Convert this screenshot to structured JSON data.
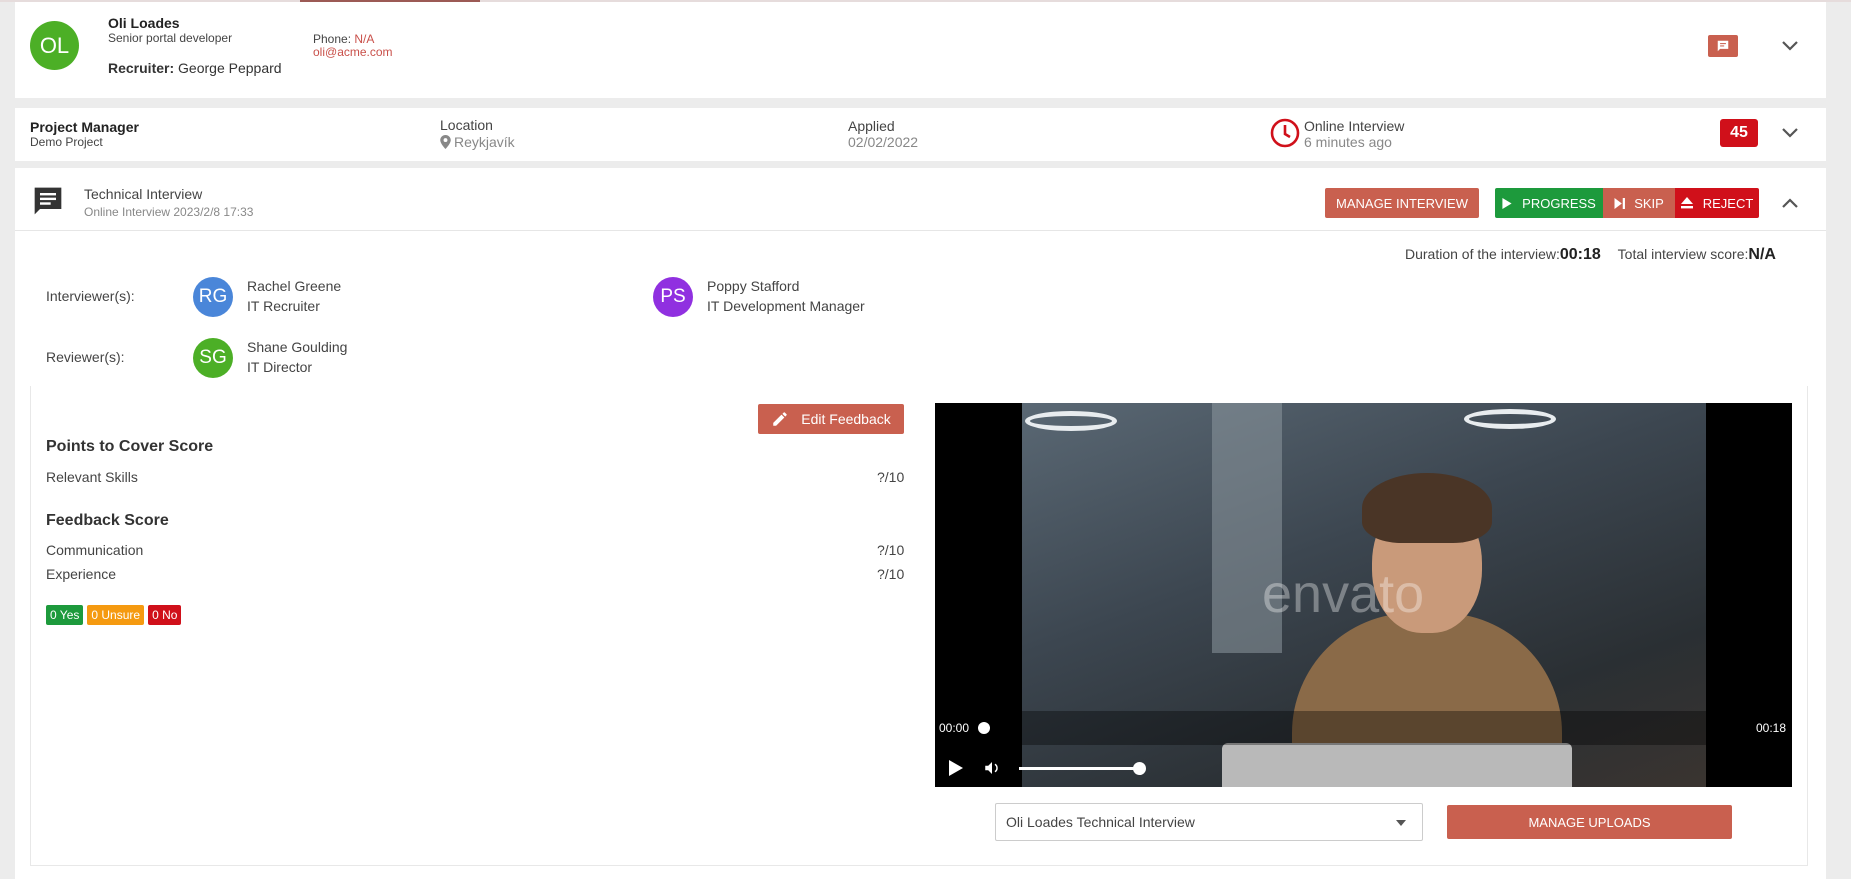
{
  "candidate": {
    "initials": "OL",
    "name": "Oli Loades",
    "title": "Senior portal developer",
    "recruiter_label": "Recruiter:",
    "recruiter": "George Peppard",
    "phone_label": "Phone:",
    "phone": "N/A",
    "email": "oli@acme.com",
    "avatar_color": "#4caf26"
  },
  "application": {
    "job_title": "Project Manager",
    "project": "Demo Project",
    "location_label": "Location",
    "location": "Reykjavík",
    "applied_label": "Applied",
    "applied": "02/02/2022",
    "stage": "Online Interview",
    "stage_time": "6 minutes ago",
    "count": "45"
  },
  "interview": {
    "title": "Technical Interview",
    "subtitle": "Online Interview 2023/2/8 17:33",
    "manage_label": "MANAGE INTERVIEW",
    "progress_label": "PROGRESS",
    "skip_label": "SKIP",
    "reject_label": "REJECT",
    "duration_label": "Duration of the interview:",
    "duration": "00:18",
    "total_label": "Total interview score:",
    "total": "N/A",
    "interviewers_label": "Interviewer(s):",
    "reviewers_label": "Reviewer(s):",
    "interviewers": [
      {
        "initials": "RG",
        "name": "Rachel Greene",
        "role": "IT Recruiter",
        "color": "#4a86d9"
      },
      {
        "initials": "PS",
        "name": "Poppy Stafford",
        "role": "IT Development Manager",
        "color": "#9030e0"
      }
    ],
    "reviewers": [
      {
        "initials": "SG",
        "name": "Shane Goulding",
        "role": "IT Director",
        "color": "#4caf26"
      }
    ]
  },
  "feedback": {
    "edit_label": "Edit Feedback",
    "points_heading": "Points to Cover Score",
    "points": [
      {
        "label": "Relevant Skills",
        "score": "?/10"
      }
    ],
    "feedback_heading": "Feedback Score",
    "scores": [
      {
        "label": "Communication",
        "score": "?/10"
      },
      {
        "label": "Experience",
        "score": "?/10"
      }
    ],
    "votes": {
      "yes": "0 Yes",
      "unsure": "0 Unsure",
      "no": "0 No"
    }
  },
  "video": {
    "current": "00:00",
    "total": "00:18",
    "progress": 0,
    "volume": 0.8,
    "watermark": "envato"
  },
  "uploads": {
    "selected": "Oli Loades Technical Interview",
    "manage_label": "MANAGE UPLOADS"
  },
  "colors": {
    "accent": "#c9604f",
    "progress": "#1d9a3c",
    "skip": "#c9604f",
    "reject": "#d0101a",
    "yes": "#1d9a3c",
    "unsure": "#f59a10",
    "no": "#d0101a"
  }
}
